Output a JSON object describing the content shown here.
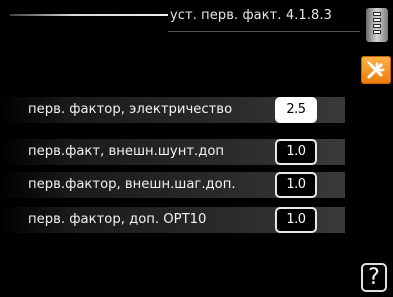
{
  "header": {
    "title": "уст. перв. факт.  4.1.8.3"
  },
  "icons": {
    "scroll": "scroll-indicator-icon",
    "tools": "tools-icon",
    "help": "help-icon",
    "tools_color": "#f08a1e"
  },
  "settings": [
    {
      "label": "перв. фактор, электричество",
      "value": "2.5",
      "selected": true
    },
    {
      "label": "перв.факт, внешн.шунт.доп",
      "value": "1.0",
      "selected": false
    },
    {
      "label": "перв.фактор, внешн.шаг.доп.",
      "value": "1.0",
      "selected": false
    },
    {
      "label": "перв. фактор, доп. OPT10",
      "value": "1.0",
      "selected": false
    }
  ],
  "help": {
    "label": "?"
  }
}
